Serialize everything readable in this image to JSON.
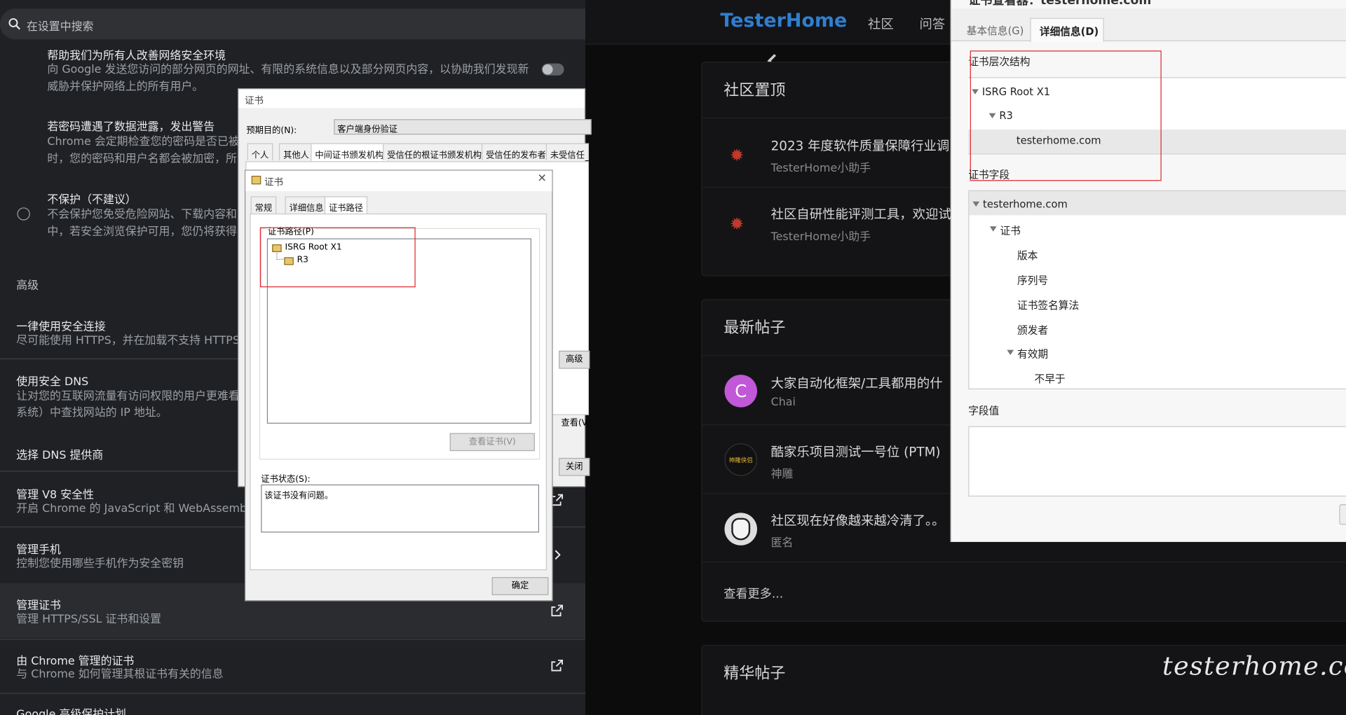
{
  "settings": {
    "search_placeholder": "在设置中搜索",
    "help_title": "帮助我们为所有人改善网络安全环境",
    "help_desc1": "向 Google 发送您访问的部分网页的网址、有限的系统信息以及部分网页内容，以协助我们发现新",
    "help_desc2": "威胁并保护网络上的所有用户。",
    "pwd_title": "若密码遭遇了数据泄露，发出警告",
    "pwd_desc1": "Chrome 会定期检查您的密码是否已被",
    "pwd_desc2": "时，您的密码和用户名都会被加密，所",
    "noprotect_title": "不保护（不建议）",
    "noprotect_desc1": "不会保护您免受危险网站、下载内容和",
    "noprotect_desc2": "中，若安全浏览保护可用，您仍将获得",
    "advanced_label": "高级",
    "https_title": "一律使用安全连接",
    "https_desc": "尽可能使用 HTTPS，并在加载不支持 HTTPS 的",
    "dns_title": "使用安全 DNS",
    "dns_desc1": "让对您的互联网流量有访问权限的用户更难看",
    "dns_desc2": "系统）中查找网站的 IP 地址。",
    "dns_provider": "选择 DNS 提供商",
    "v8_title": "管理 V8 安全性",
    "v8_desc": "开启 Chrome 的 JavaScript 和 WebAssembly 引",
    "phone_title": "管理手机",
    "phone_desc": "控制您使用哪些手机作为安全密钥",
    "cert_title": "管理证书",
    "cert_desc": "管理 HTTPS/SSL 证书和设置",
    "chrome_cert_title": "由 Chrome 管理的证书",
    "chrome_cert_desc": "与 Chrome 如何管理其根证书有关的信息",
    "gapp_title": "Google 高级保护计划"
  },
  "site": {
    "logo": "TesterHome",
    "nav": [
      "社区",
      "问答"
    ],
    "pinned_title": "社区置顶",
    "pinned": [
      {
        "title": "2023 年度软件质量保障行业调",
        "author": "TesterHome小助手"
      },
      {
        "title": "社区自研性能评测工具，欢迎试",
        "author": "TesterHome小助手"
      }
    ],
    "latest_title": "最新帖子",
    "latest": [
      {
        "title": "大家自动化框架/工具都用的什",
        "author": "Chai",
        "avatar_letter": "C"
      },
      {
        "title": "酷家乐项目测试一号位 (PTM)",
        "author": "神雕"
      },
      {
        "title": "社区现在好像越来越冷清了。。",
        "author": "匿名"
      }
    ],
    "more": "查看更多...",
    "featured_title": "精华帖子",
    "avatar_badge": "神雕侠侣"
  },
  "cert_outer": {
    "title": "证书",
    "purpose_label": "预期目的(N):",
    "purpose_value": "客户端身份验证",
    "tabs": [
      "个人",
      "其他人",
      "中间证书颁发机构",
      "受信任的根证书颁发机构",
      "受信任的发布者",
      "未受信任的发"
    ],
    "btn_advanced": "高级",
    "btn_view": "查看(V",
    "btn_close": "关闭"
  },
  "cert_inner": {
    "title": "证书",
    "tabs": [
      "常规",
      "详细信息",
      "证书路径"
    ],
    "path_label": "证书路径(P)",
    "path_items": [
      "ISRG Root X1",
      "R3"
    ],
    "view_btn": "查看证书(V)",
    "status_label": "证书状态(S):",
    "status_text": "该证书没有问题。",
    "ok_btn": "确定"
  },
  "viewer": {
    "title": "证书查看器：testerhome.com",
    "tabs": [
      "基本信息(G)",
      "详细信息(D)"
    ],
    "hierarchy_label": "证书层次结构",
    "hierarchy": [
      "ISRG Root X1",
      "R3",
      "testerhome.com"
    ],
    "fields_label": "证书字段",
    "fields": [
      "testerhome.com",
      "证书",
      "版本",
      "序列号",
      "证书签名算法",
      "颁发者",
      "有效期",
      "不早于"
    ],
    "value_label": "字段值"
  },
  "watermark": "testerhome.com",
  "colors": {
    "accent_logo": "#2f7fcf",
    "red_highlight": "#e0262c",
    "settings_bg": "#202124"
  }
}
